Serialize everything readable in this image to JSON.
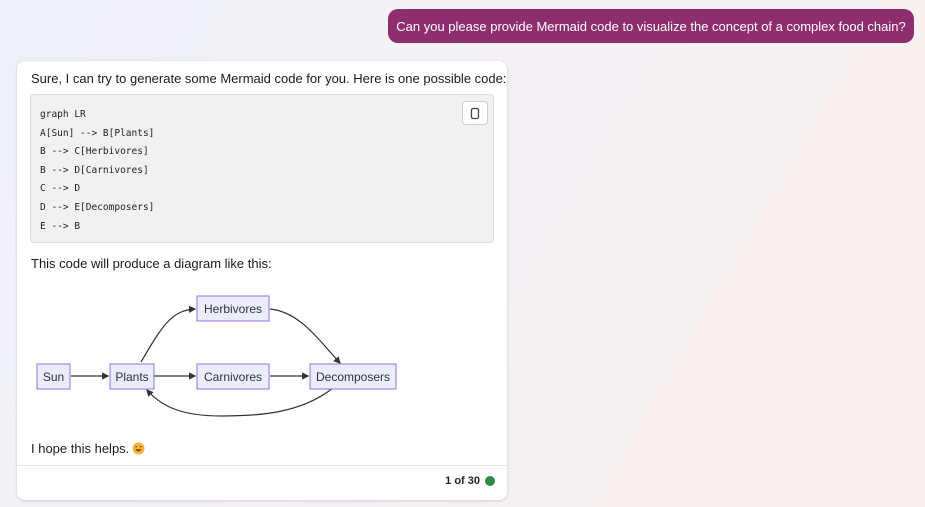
{
  "user_message": "Can you please provide Mermaid code to visualize the concept of a complex food chain?",
  "response": {
    "intro": "Sure, I can try to generate some Mermaid code for you. Here is one possible code:",
    "code_lines": [
      "graph LR",
      "A[Sun] --> B[Plants]",
      "B --> C[Herbivores]",
      "B --> D[Carnivores]",
      "C --> D",
      "D --> E[Decomposers]",
      "E --> B"
    ],
    "copy_icon": "copy-icon",
    "followup": "This code will produce a diagram like this:",
    "diagram": {
      "nodes": {
        "sun": "Sun",
        "plants": "Plants",
        "herbivores": "Herbivores",
        "carnivores": "Carnivores",
        "decomposers": "Decomposers"
      }
    },
    "closing": "I hope this helps.",
    "emoji": "smile-emoji",
    "counter": "1 of 30",
    "status_color": "#2f8a49"
  }
}
